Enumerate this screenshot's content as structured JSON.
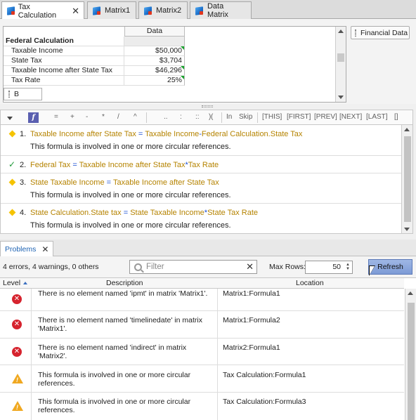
{
  "tabs": [
    {
      "label": "Tax Calculation",
      "active": true
    },
    {
      "label": "Matrix1"
    },
    {
      "label": "Matrix2"
    },
    {
      "label": "Data Matrix"
    }
  ],
  "grid": {
    "column_header": "Data",
    "rows": [
      {
        "label": "Federal Calculation",
        "value": ""
      },
      {
        "label": "Taxable Income",
        "value": "$50,000"
      },
      {
        "label": "State Tax",
        "value": "$3,704"
      },
      {
        "label": "Taxable Income after State Tax",
        "value": "$46,296"
      },
      {
        "label": "Tax Rate",
        "value": "25%"
      }
    ]
  },
  "financial_data_button": "Financial Data",
  "name_field": "B",
  "formula_toolbar": {
    "fx": "f",
    "ops": [
      "=",
      "+",
      "-",
      "*",
      "/",
      "^",
      "..",
      ":",
      "::",
      "(",
      ")"
    ],
    "keywords": [
      "In",
      "Skip",
      "[THIS]",
      "[FIRST]",
      "[PREV]",
      "[NEXT]",
      "[LAST]",
      "[]"
    ]
  },
  "formulas": [
    {
      "num": "1.",
      "lhs": "Taxable Income after State Tax",
      "eq": "=",
      "rhs_a": "Taxable Income",
      "op": "-",
      "rhs_b": "Federal Calculation.State Tax",
      "msg": "This formula is involved in one or more circular references.",
      "status": "warning"
    },
    {
      "num": "2.",
      "lhs": "Federal Tax",
      "eq": "=",
      "rhs_a": "Taxable Income after State Tax",
      "op": "*",
      "rhs_b": "Tax Rate",
      "msg": "",
      "status": "ok"
    },
    {
      "num": "3.",
      "lhs": "State Taxable Income",
      "eq": "=",
      "rhs_a": "Taxable Income after State Tax",
      "op": "",
      "rhs_b": "",
      "msg": "This formula is involved in one or more circular references.",
      "status": "warning"
    },
    {
      "num": "4.",
      "lhs": "State Calculation.State tax",
      "eq": "=",
      "rhs_a": "State Taxable Income",
      "op": "*",
      "rhs_b": "State Tax Rate",
      "msg": "This formula is involved in one or more circular references.",
      "status": "warning"
    }
  ],
  "problems": {
    "tab_label": "Problems",
    "summary": "4 errors, 4 warnings, 0 others",
    "filter_placeholder": "Filter",
    "max_rows_label": "Max Rows:",
    "max_rows_value": "50",
    "refresh_label": "Refresh",
    "columns": [
      "Level",
      "Description",
      "Location"
    ],
    "rows": [
      {
        "level": "error",
        "description": "There is no element named 'ipmt' in matrix 'Matrix1'.",
        "location": "Matrix1:Formula1"
      },
      {
        "level": "error",
        "description": "There is no element named 'timelinedate' in matrix 'Matrix1'.",
        "location": "Matrix1:Formula2"
      },
      {
        "level": "error",
        "description": "There is no element named 'indirect' in matrix 'Matrix2'.",
        "location": "Matrix2:Formula1"
      },
      {
        "level": "warning",
        "description": "This formula is involved in one or more circular references.",
        "location": "Tax Calculation:Formula1"
      },
      {
        "level": "warning",
        "description": "This formula is involved in one or more circular references.",
        "location": "Tax Calculation:Formula3"
      }
    ]
  }
}
